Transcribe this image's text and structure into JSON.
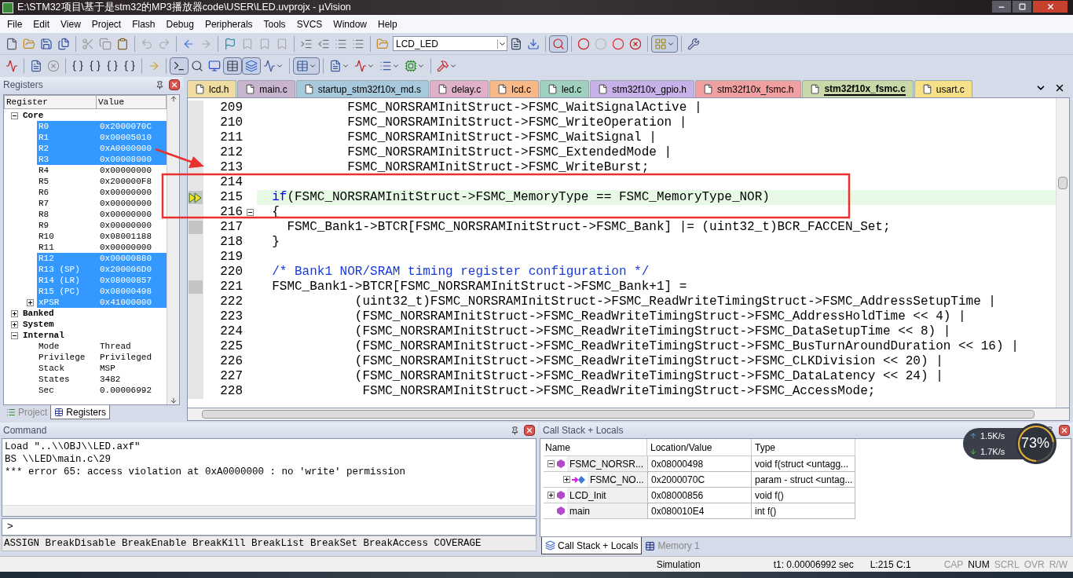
{
  "window": {
    "title": "E:\\STM32项目\\基于是stm32的MP3播放器code\\USER\\LED.uvprojx - µVision"
  },
  "menu": [
    "File",
    "Edit",
    "View",
    "Project",
    "Flash",
    "Debug",
    "Peripherals",
    "Tools",
    "SVCS",
    "Window",
    "Help"
  ],
  "target_select": {
    "value": "LCD_LED"
  },
  "registers": {
    "title": "Registers",
    "columns": [
      "Register",
      "Value"
    ],
    "tree": [
      {
        "name": "Core",
        "expanded": true,
        "selected": false,
        "children": [
          {
            "name": "R0",
            "value": "0x2000070C",
            "selected": true
          },
          {
            "name": "R1",
            "value": "0x00005010",
            "selected": true
          },
          {
            "name": "R2",
            "value": "0xA0000000",
            "selected": true
          },
          {
            "name": "R3",
            "value": "0x00008000",
            "selected": true
          },
          {
            "name": "R4",
            "value": "0x00000000",
            "selected": false
          },
          {
            "name": "R5",
            "value": "0x200000F8",
            "selected": false
          },
          {
            "name": "R6",
            "value": "0x00000000",
            "selected": false
          },
          {
            "name": "R7",
            "value": "0x00000000",
            "selected": false
          },
          {
            "name": "R8",
            "value": "0x00000000",
            "selected": false
          },
          {
            "name": "R9",
            "value": "0x00000000",
            "selected": false
          },
          {
            "name": "R10",
            "value": "0x08001188",
            "selected": false
          },
          {
            "name": "R11",
            "value": "0x00000000",
            "selected": false
          },
          {
            "name": "R12",
            "value": "0x00000880",
            "selected": true
          },
          {
            "name": "R13 (SP)",
            "value": "0x200006D0",
            "selected": true
          },
          {
            "name": "R14 (LR)",
            "value": "0x08000857",
            "selected": true
          },
          {
            "name": "R15 (PC)",
            "value": "0x08000498",
            "selected": true
          },
          {
            "name": "xPSR",
            "value": "0x41000000",
            "selected": true,
            "expanded": false
          }
        ]
      },
      {
        "name": "Banked",
        "expanded": false,
        "selected": false
      },
      {
        "name": "System",
        "expanded": false,
        "selected": false
      },
      {
        "name": "Internal",
        "expanded": true,
        "selected": false,
        "children": [
          {
            "name": "Mode",
            "value": "Thread",
            "selected": false
          },
          {
            "name": "Privilege",
            "value": "Privileged",
            "selected": false
          },
          {
            "name": "Stack",
            "value": "MSP",
            "selected": false
          },
          {
            "name": "States",
            "value": "3482",
            "selected": false
          },
          {
            "name": "Sec",
            "value": "0.00006992",
            "selected": false
          }
        ]
      }
    ]
  },
  "panel_tabs": [
    {
      "label": "Project",
      "selected": false
    },
    {
      "label": "Registers",
      "selected": true
    }
  ],
  "editor_tabs": [
    {
      "label": "lcd.h",
      "color": "#f0dca0",
      "selected": false
    },
    {
      "label": "main.c",
      "color": "#c8b4cc",
      "selected": false
    },
    {
      "label": "startup_stm32f10x_md.s",
      "color": "#a8c8dc",
      "selected": false
    },
    {
      "label": "delay.c",
      "color": "#e0b0c8",
      "selected": false
    },
    {
      "label": "lcd.c",
      "color": "#f8b888",
      "selected": false
    },
    {
      "label": "led.c",
      "color": "#a0d0c0",
      "selected": false
    },
    {
      "label": "stm32f10x_gpio.h",
      "color": "#c8b0e8",
      "selected": false
    },
    {
      "label": "stm32f10x_fsmc.h",
      "color": "#f0a0a0",
      "selected": false
    },
    {
      "label": "stm32f10x_fsmc.c",
      "color": "#c8d8a8",
      "selected": true
    },
    {
      "label": "usart.c",
      "color": "#f8e088",
      "selected": false
    }
  ],
  "code_lines": [
    {
      "number": "209",
      "current": false,
      "executable": false,
      "fold": false,
      "segments": [
        {
          "kind": "plain",
          "text": "            FSMC_NORSRAMInitStruct->FSMC_WaitSignalActive |"
        }
      ]
    },
    {
      "number": "210",
      "current": false,
      "executable": false,
      "fold": false,
      "segments": [
        {
          "kind": "plain",
          "text": "            FSMC_NORSRAMInitStruct->FSMC_WriteOperation |"
        }
      ]
    },
    {
      "number": "211",
      "current": false,
      "executable": false,
      "fold": false,
      "segments": [
        {
          "kind": "plain",
          "text": "            FSMC_NORSRAMInitStruct->FSMC_WaitSignal |"
        }
      ]
    },
    {
      "number": "212",
      "current": false,
      "executable": false,
      "fold": false,
      "segments": [
        {
          "kind": "plain",
          "text": "            FSMC_NORSRAMInitStruct->FSMC_ExtendedMode |"
        }
      ]
    },
    {
      "number": "213",
      "current": false,
      "executable": false,
      "fold": false,
      "segments": [
        {
          "kind": "plain",
          "text": "            FSMC_NORSRAMInitStruct->FSMC_WriteBurst;"
        }
      ]
    },
    {
      "number": "214",
      "current": false,
      "executable": false,
      "fold": false
    },
    {
      "number": "215",
      "current": true,
      "executable": true,
      "fold": false,
      "segments": [
        {
          "kind": "keyword",
          "text": "  if"
        },
        {
          "kind": "plain",
          "text": "(FSMC_NORSRAMInitStruct->FSMC_MemoryType == FSMC_MemoryType_NOR)"
        }
      ]
    },
    {
      "number": "216",
      "current": false,
      "executable": false,
      "fold": true,
      "segments": [
        {
          "kind": "plain",
          "text": "  {"
        }
      ]
    },
    {
      "number": "217",
      "current": false,
      "executable": true,
      "fold": false,
      "segments": [
        {
          "kind": "plain",
          "text": "    FSMC_Bank1->BTCR[FSMC_NORSRAMInitStruct->FSMC_Bank] |= (uint32_t)BCR_FACCEN_Set;"
        }
      ]
    },
    {
      "number": "218",
      "current": false,
      "executable": false,
      "fold": false,
      "segments": [
        {
          "kind": "plain",
          "text": "  }"
        }
      ]
    },
    {
      "number": "219",
      "current": false,
      "executable": false,
      "fold": false
    },
    {
      "number": "220",
      "current": false,
      "executable": false,
      "fold": false,
      "segments": [
        {
          "kind": "comment",
          "text": "  /* Bank1 NOR/SRAM timing register configuration */"
        }
      ]
    },
    {
      "number": "221",
      "current": false,
      "executable": true,
      "fold": false,
      "segments": [
        {
          "kind": "plain",
          "text": "  FSMC_Bank1->BTCR[FSMC_NORSRAMInitStruct->FSMC_Bank+1] ="
        }
      ]
    },
    {
      "number": "222",
      "current": false,
      "executable": false,
      "fold": false,
      "segments": [
        {
          "kind": "plain",
          "text": "             (uint32_t)FSMC_NORSRAMInitStruct->FSMC_ReadWriteTimingStruct->FSMC_AddressSetupTime |"
        }
      ]
    },
    {
      "number": "223",
      "current": false,
      "executable": false,
      "fold": false,
      "segments": [
        {
          "kind": "plain",
          "text": "             (FSMC_NORSRAMInitStruct->FSMC_ReadWriteTimingStruct->FSMC_AddressHoldTime << 4) |"
        }
      ]
    },
    {
      "number": "224",
      "current": false,
      "executable": false,
      "fold": false,
      "segments": [
        {
          "kind": "plain",
          "text": "             (FSMC_NORSRAMInitStruct->FSMC_ReadWriteTimingStruct->FSMC_DataSetupTime << 8) |"
        }
      ]
    },
    {
      "number": "225",
      "current": false,
      "executable": false,
      "fold": false,
      "segments": [
        {
          "kind": "plain",
          "text": "             (FSMC_NORSRAMInitStruct->FSMC_ReadWriteTimingStruct->FSMC_BusTurnAroundDuration << 16) |"
        }
      ]
    },
    {
      "number": "226",
      "current": false,
      "executable": false,
      "fold": false,
      "segments": [
        {
          "kind": "plain",
          "text": "             (FSMC_NORSRAMInitStruct->FSMC_ReadWriteTimingStruct->FSMC_CLKDivision << 20) |"
        }
      ]
    },
    {
      "number": "227",
      "current": false,
      "executable": false,
      "fold": false,
      "segments": [
        {
          "kind": "plain",
          "text": "             (FSMC_NORSRAMInitStruct->FSMC_ReadWriteTimingStruct->FSMC_DataLatency << 24) |"
        }
      ]
    },
    {
      "number": "228",
      "current": false,
      "executable": false,
      "fold": false,
      "segments": [
        {
          "kind": "plain",
          "text": "              FSMC_NORSRAMInitStruct->FSMC_ReadWriteTimingStruct->FSMC_AccessMode;"
        }
      ]
    }
  ],
  "command": {
    "title": "Command",
    "output": [
      "Load \"..\\\\OBJ\\\\LED.axf\"",
      "BS \\\\LED\\main.c\\29",
      "*** error 65: access violation at 0xA0000000 : no 'write' permission"
    ],
    "prompt": ">",
    "hint": "ASSIGN BreakDisable BreakEnable BreakKill BreakList BreakSet BreakAccess COVERAGE"
  },
  "call_stack": {
    "title": "Call Stack + Locals",
    "columns": [
      "Name",
      "Location/Value",
      "Type"
    ],
    "rows": [
      {
        "kind": "function",
        "name": "FSMC_NORSR...",
        "location": "0x08000498",
        "type": "void f(struct <untagg...",
        "expanded": true,
        "children": [
          {
            "kind": "param",
            "name": "FSMC_NO...",
            "location": "0x2000070C",
            "type": "param - struct <untag...",
            "expanded": false
          }
        ]
      },
      {
        "kind": "function",
        "name": "LCD_Init",
        "location": "0x08000856",
        "type": "void f()",
        "expanded": false
      },
      {
        "kind": "function",
        "name": "main",
        "location": "0x080010E4",
        "type": "int f()"
      }
    ],
    "tabs": [
      {
        "label": "Call Stack + Locals",
        "selected": true
      },
      {
        "label": "Memory 1",
        "selected": false
      }
    ]
  },
  "net_monitor": {
    "upload": "1.5K/s",
    "download": "1.7K/s",
    "percent": "73%",
    "level": 0.73
  },
  "status_bar": {
    "mode": "Simulation",
    "time": "t1: 0.00006992 sec",
    "position": "L:215 C:1",
    "indicators": [
      {
        "label": "CAP",
        "on": false
      },
      {
        "label": "NUM",
        "on": true
      },
      {
        "label": "SCRL",
        "on": false
      },
      {
        "label": "OVR",
        "on": false
      },
      {
        "label": "R/W",
        "on": false
      }
    ]
  }
}
